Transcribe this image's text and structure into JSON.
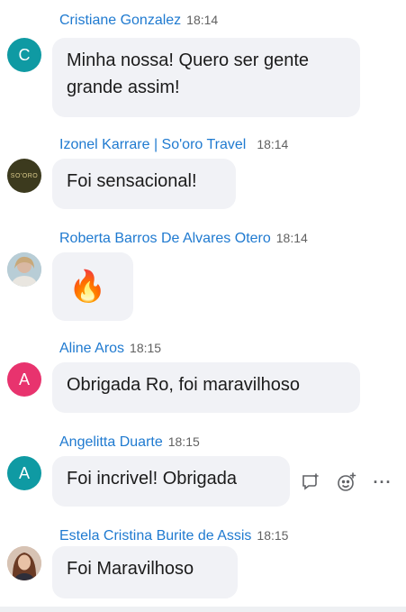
{
  "messages": [
    {
      "author": "Cristiane Gonzalez",
      "time": "18:14",
      "avatar_letter": "C",
      "avatar_color": "#0f9aa3",
      "text": "Minha nossa! Quero ser gente grande assim!"
    },
    {
      "author": "Izonel Karrare | So'oro Travel",
      "time": "18:14",
      "avatar_text": "SO'ORO",
      "avatar_color": "#3c3a1e",
      "text": "Foi sensacional!"
    },
    {
      "author": "Roberta Barros De Alvares Otero",
      "time": "18:14",
      "avatar_photo": "photo-avatar",
      "text": "🔥"
    },
    {
      "author": "Aline Aros",
      "time": "18:15",
      "avatar_letter": "A",
      "avatar_color": "#e8336e",
      "text": "Obrigada Ro, foi maravilhoso"
    },
    {
      "author": "Angelitta Duarte",
      "time": "18:15",
      "avatar_letter": "A",
      "avatar_color": "#0f9aa3",
      "text": "Foi incrivel! Obrigada"
    },
    {
      "author": "Estela Cristina Burite de Assis",
      "time": "18:15",
      "avatar_photo": "photo-avatar",
      "text": "Foi Maravilhoso"
    }
  ],
  "actions": {
    "reply_icon": "reply-icon",
    "emoji_icon": "add-reaction-icon",
    "more_icon": "more-options-icon",
    "more_label": "···"
  }
}
